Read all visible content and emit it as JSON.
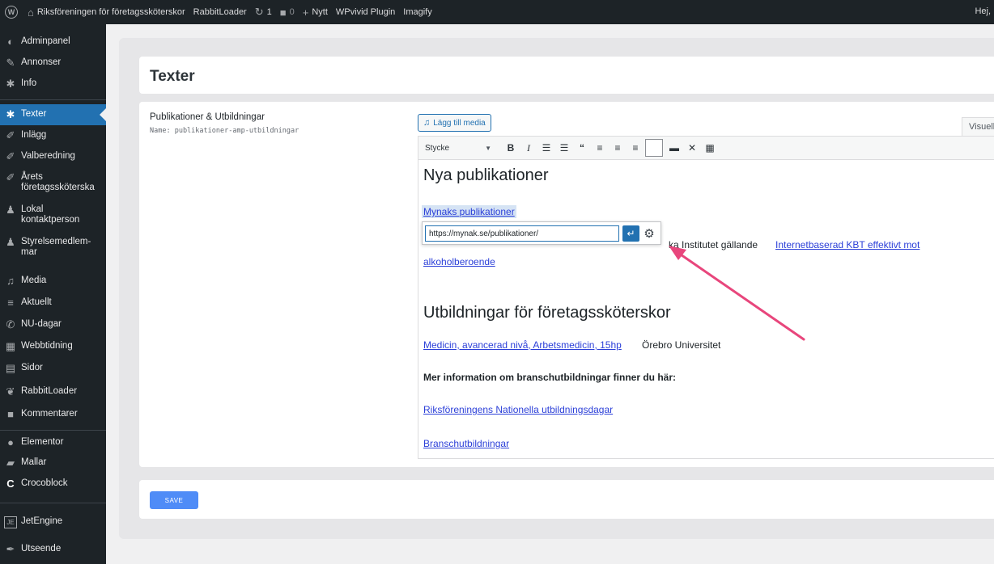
{
  "adminbar": {
    "site_name": "Riksföreningen för företagssköterskor",
    "rabbitloader": "RabbitLoader",
    "updates_count": "1",
    "comments_count": "0",
    "new_label": "Nytt",
    "wpvivid": "WPvivid Plugin",
    "imagify": "Imagify",
    "greeting": "Hej,"
  },
  "sidebar": {
    "items": [
      {
        "label": "Adminpanel",
        "icon": "dashboard-icon"
      },
      {
        "label": "Annonser",
        "icon": "pen-icon"
      },
      {
        "label": "Info",
        "icon": "gear-icon"
      },
      {
        "label": "Texter",
        "icon": "gear-icon"
      },
      {
        "label": "Inlägg",
        "icon": "pin-icon"
      },
      {
        "label": "Valberedning",
        "icon": "pin-icon"
      },
      {
        "label": "Årets företagssköterska",
        "icon": "pin-icon"
      },
      {
        "label": "Lokal kontaktperson",
        "icon": "user-icon"
      },
      {
        "label": "Styrelsemedlem-mar",
        "icon": "user-icon"
      },
      {
        "label": "Media",
        "icon": "media-icon"
      },
      {
        "label": "Aktuellt",
        "icon": "list-icon"
      },
      {
        "label": "NU-dagar",
        "icon": "megaphone-icon"
      },
      {
        "label": "Webbtidning",
        "icon": "newspaper-icon"
      },
      {
        "label": "Sidor",
        "icon": "page-icon"
      },
      {
        "label": "RabbitLoader",
        "icon": "rabbit-icon"
      },
      {
        "label": "Kommentarer",
        "icon": "comment-icon"
      },
      {
        "label": "Elementor",
        "icon": "elementor-icon"
      },
      {
        "label": "Mallar",
        "icon": "folder-icon"
      },
      {
        "label": "Crocoblock",
        "icon": "crocoblock-icon"
      },
      {
        "label": "JetEngine",
        "icon": "jetengine-icon"
      },
      {
        "label": "Utseende",
        "icon": "brush-icon"
      }
    ]
  },
  "page": {
    "title": "Texter",
    "field_label": "Publikationer & Utbildningar",
    "field_name": "Name: publikationer-amp-utbildningar",
    "save_label": "SAVE"
  },
  "editor": {
    "add_media": "Lägg till media",
    "visual_tab": "Visuell",
    "format_select": "Stycke",
    "content": {
      "heading1": "Nya publikationer",
      "link1": "Mynaks publikationer",
      "para_prefix": "ka Institutet gällande",
      "para_link": "Internetbaserad KBT effektivt mot",
      "para_link2": "alkoholberoende",
      "heading2": "Utbildningar för företagssköterskor",
      "course_link": "Medicin, avancerad nivå, Arbetsmedicin, 15hp",
      "course_uni": "Örebro Universitet",
      "more_info": "Mer information om branschutbildningar finner du här:",
      "link_days": "Riksföreningens Nationella utbildningsdagar",
      "link_branch": "Branschutbildningar"
    },
    "link_popup": {
      "url": "https://mynak.se/publikationer/"
    }
  },
  "colors": {
    "accent": "#2271b1",
    "annotation_arrow": "#e8467c",
    "link": "#2b3fd8",
    "sidebar_bg": "#1d2327"
  }
}
